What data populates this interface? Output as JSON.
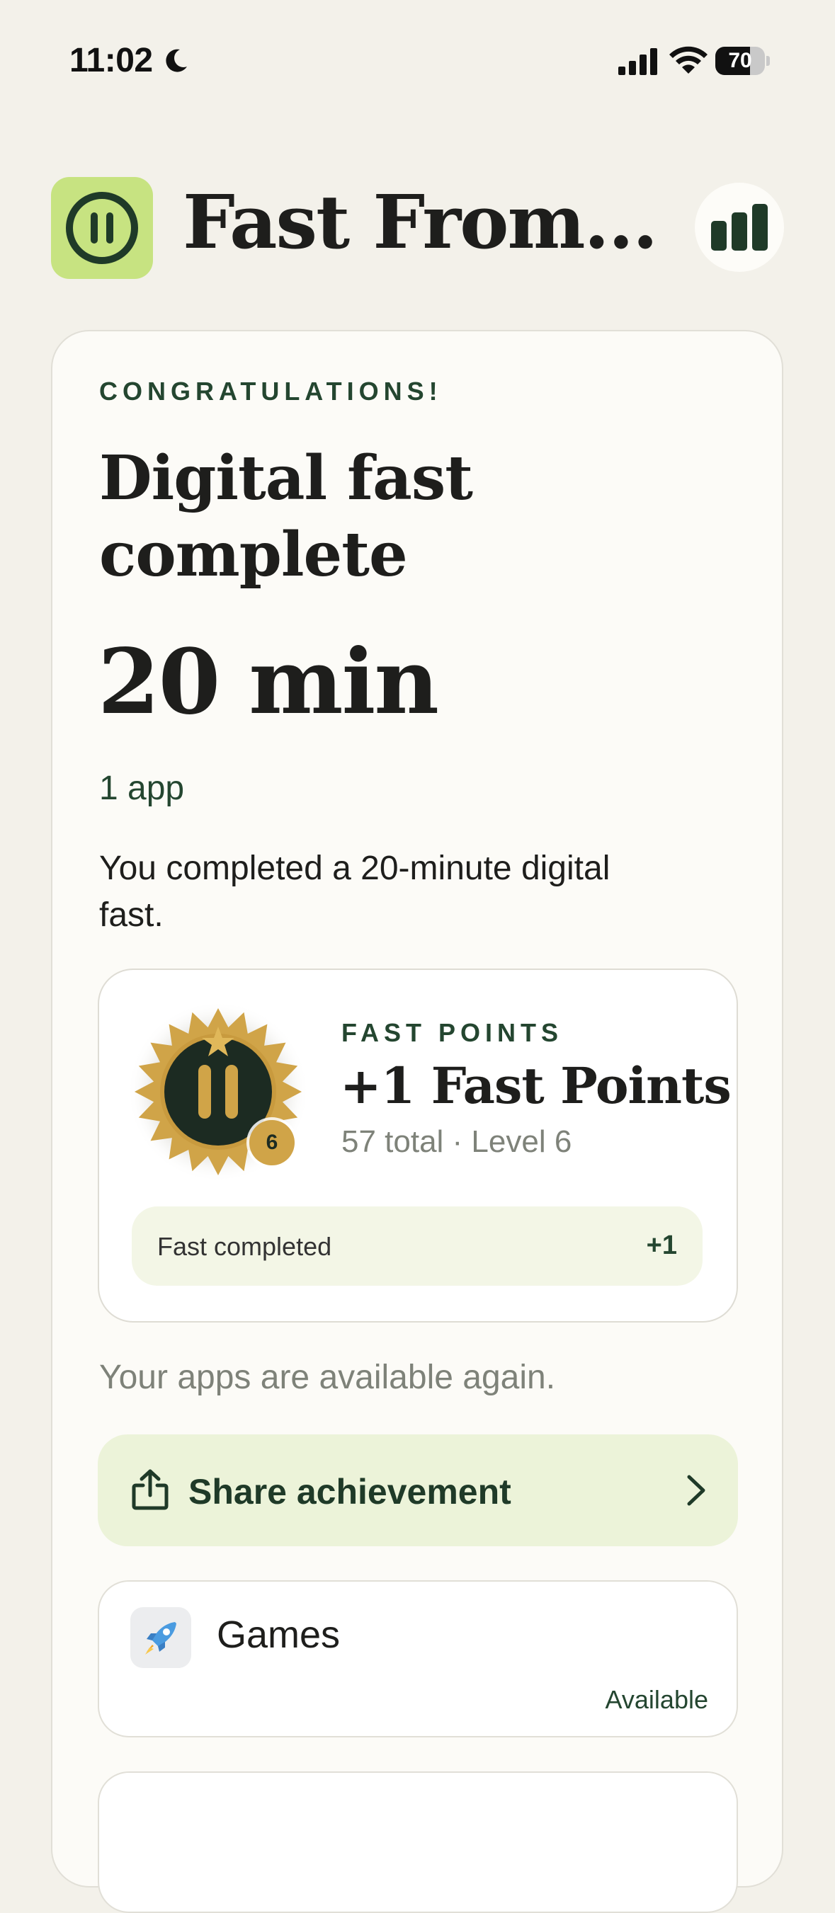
{
  "status_bar": {
    "time": "11:02",
    "battery_percent": 70
  },
  "header": {
    "title": "Fast From...",
    "logo_icon": "pause-circle-icon",
    "stats_icon": "bar-chart-icon",
    "logo_color": "#C7E381"
  },
  "result": {
    "eyebrow": "CONGRATULATIONS!",
    "headline": "Digital fast complete",
    "duration": "20 min",
    "app_count": "1 app",
    "summary": "You completed a 20-minute digital fast."
  },
  "points": {
    "label": "FAST POINTS",
    "value": "+1 Fast Points",
    "meta": "57 total · Level 6",
    "badge_level": "6",
    "row_label": "Fast completed",
    "row_value": "+1",
    "badge_color": "#D0A448"
  },
  "available_note": "Your apps are available again.",
  "share": {
    "label": "Share achievement",
    "icon": "share-icon"
  },
  "apps": [
    {
      "name": "Games",
      "status": "Available",
      "icon": "rocket-icon"
    }
  ],
  "colors": {
    "background": "#F3F1EA",
    "accent_dark": "#244630",
    "share_bg": "#ECF3D9"
  }
}
